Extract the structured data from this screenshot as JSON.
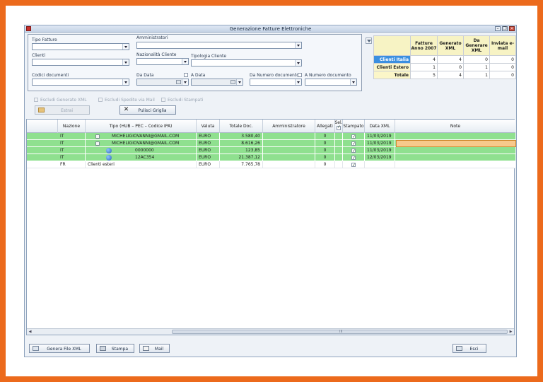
{
  "window": {
    "title": "Generazione Fatture Elettroniche"
  },
  "filters": {
    "tipo_fatture_label": "Tipo Fatture",
    "amministratori_label": "Amministratori",
    "clienti_label": "Clienti",
    "nazionalita_label": "Nazionalità Cliente",
    "tipologia_label": "Tipologia Cliente",
    "codici_label": "Codici documenti",
    "da_data_label": "Da Data",
    "a_data_label": "A Data",
    "da_numero_label": "Da Numero documento",
    "a_numero_label": "A Numero documento",
    "escludi_xml": "Escludi Generate XML",
    "escludi_mail": "Escludi Spedite via Mail",
    "escludi_stampati": "Escludi Stampati",
    "estrai": "Estrai",
    "pulisci": "Pulisci Griglia"
  },
  "summary": {
    "headers": [
      "Fatture Anno 2007",
      "Generato XML",
      "Da Generare XML",
      "Inviata e-mail"
    ],
    "rows": [
      {
        "label": "Clienti Italia",
        "values": [
          "4",
          "4",
          "0",
          "0"
        ]
      },
      {
        "label": "Clienti Estero",
        "values": [
          "1",
          "0",
          "1",
          "0"
        ]
      },
      {
        "label": "Totale",
        "values": [
          "5",
          "4",
          "1",
          "0"
        ]
      }
    ]
  },
  "grid": {
    "headers": [
      "Nazione",
      "Tipo (HUB – PEC – Codice IPA)",
      "Valuta",
      "Totale Doc.",
      "Amministratore",
      "Allegati",
      "Sel.",
      "Stampato",
      "Data XML",
      "Note"
    ],
    "rows": [
      {
        "nazione": "IT",
        "tipo": "MICHELIGIOVANNI@GMAIL.COM",
        "valuta": "EURO",
        "totale": "3.580,40",
        "amministratore": "",
        "allegati": "0",
        "data_xml": "11/03/2019",
        "note": ""
      },
      {
        "nazione": "IT",
        "tipo": "MICHELIGIOVANNI@GMAIL.COM",
        "valuta": "EURO",
        "totale": "8.616,26",
        "amministratore": "",
        "allegati": "0",
        "data_xml": "11/03/2019",
        "note": ""
      },
      {
        "nazione": "IT",
        "tipo": "0000000",
        "valuta": "EURO",
        "totale": "123,85",
        "amministratore": "",
        "allegati": "0",
        "data_xml": "11/03/2019",
        "note": ""
      },
      {
        "nazione": "IT",
        "tipo": "12AC354",
        "valuta": "EURO",
        "totale": "21.387,12",
        "amministratore": "",
        "allegati": "0",
        "data_xml": "12/03/2019",
        "note": ""
      },
      {
        "nazione": "FR",
        "tipo": "Clienti esteri",
        "valuta": "EURO",
        "totale": "7.765,78",
        "amministratore": "",
        "allegati": "0",
        "data_xml": "",
        "note": ""
      }
    ],
    "scroll_label": "III"
  },
  "footer": {
    "genera": "Genera File XML",
    "stampa": "Stampa",
    "mail": "Mail",
    "esci": "Esci"
  },
  "colors": {
    "row_green": "#8fe08f",
    "selected_header": "#3b8fe0",
    "summary_header": "#f7f3c4",
    "frame": "#ec6a1c"
  }
}
